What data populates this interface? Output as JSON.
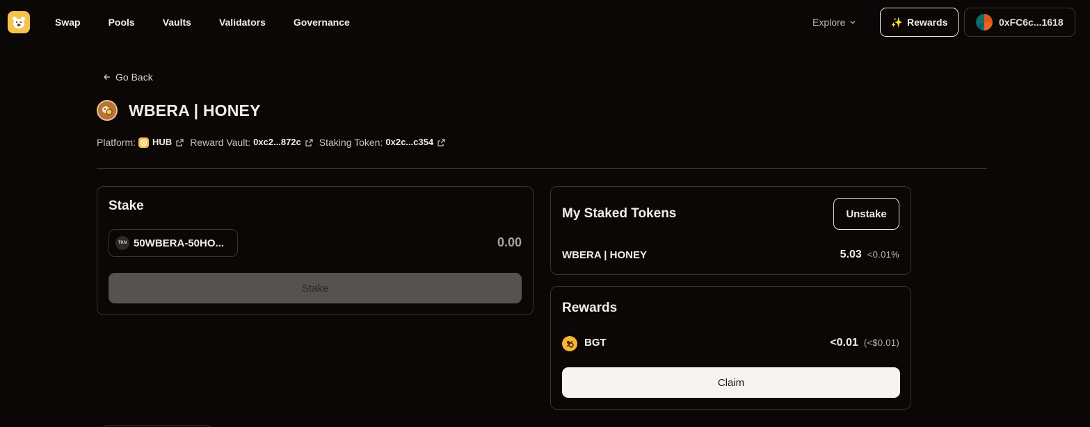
{
  "nav": {
    "logo_icon": "bear-logo-icon",
    "links": [
      "Swap",
      "Pools",
      "Vaults",
      "Validators",
      "Governance"
    ],
    "explore_label": "Explore",
    "rewards_label": "Rewards",
    "rewards_icon": "sparkle-icon",
    "wallet_address": "0xFC6c...1618"
  },
  "page": {
    "go_back_label": "Go Back",
    "title": "WBERA | HONEY",
    "meta": {
      "platform_label": "Platform:",
      "platform_value": "HUB",
      "reward_vault_label": "Reward Vault:",
      "reward_vault_value": "0xc2...872c",
      "staking_token_label": "Staking Token:",
      "staking_token_value": "0x2c...c354"
    }
  },
  "stake_card": {
    "title": "Stake",
    "token_icon_text": "TKN",
    "token_name": "50WBERA-50HO...",
    "amount_placeholder": "0.00",
    "button_label": "Stake"
  },
  "staked_card": {
    "title": "My Staked Tokens",
    "unstake_label": "Unstake",
    "token_label": "WBERA | HONEY",
    "amount": "5.03",
    "share": "<0.01%"
  },
  "rewards_card": {
    "title": "Rewards",
    "token_label": "BGT",
    "amount": "<0.01",
    "usd_value": "(<$0.01)",
    "claim_label": "Claim"
  },
  "colors": {
    "background": "#0b0706",
    "accent": "#f5c24c",
    "border": "#3a3431",
    "text": "#f1ede8"
  }
}
